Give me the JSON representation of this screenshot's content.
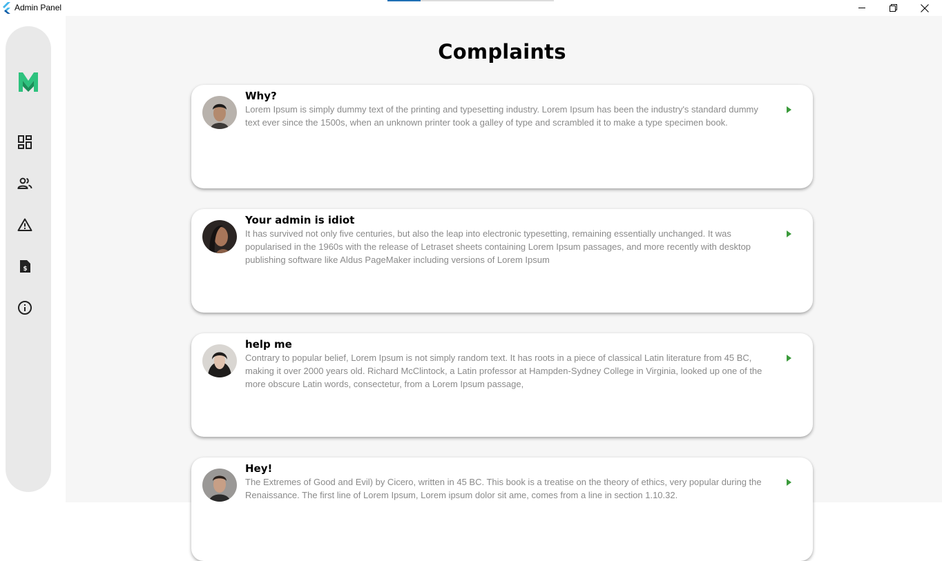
{
  "window": {
    "title": "Admin Panel",
    "progress": 0.2,
    "colors": {
      "accent": "#1f6fb5",
      "brand_green": "#2ec27e",
      "arrow_green": "#3a9a3a"
    }
  },
  "sidebar": {
    "brand_icon": "brand-m-logo-icon",
    "items": [
      {
        "name": "dashboard",
        "icon": "dashboard-icon"
      },
      {
        "name": "users",
        "icon": "people-icon"
      },
      {
        "name": "complaints",
        "icon": "warning-icon"
      },
      {
        "name": "billing",
        "icon": "invoice-icon"
      },
      {
        "name": "about",
        "icon": "info-icon"
      }
    ]
  },
  "page": {
    "title": "Complaints"
  },
  "complaints": [
    {
      "title": "Why?",
      "body": "Lorem Ipsum is simply dummy text of the printing and typesetting industry. Lorem Ipsum has been the industry's standard dummy text ever since the 1500s, when an unknown printer took a galley of type and scrambled it to make a type specimen book."
    },
    {
      "title": "Your admin is idiot",
      "body": "It has survived not only five centuries, but also the leap into electronic typesetting, remaining essentially unchanged. It was popularised in the 1960s with the release of Letraset sheets containing Lorem Ipsum passages, and more recently with desktop publishing software like Aldus PageMaker including versions of Lorem Ipsum"
    },
    {
      "title": "help me",
      "body": "Contrary to popular belief, Lorem Ipsum is not simply random text. It has roots in a piece of classical Latin literature from 45 BC, making it over 2000 years old. Richard McClintock, a Latin professor at Hampden-Sydney College in Virginia, looked up one of the more obscure Latin words, consectetur, from a Lorem Ipsum passage,"
    },
    {
      "title": "Hey!",
      "body": "The Extremes of Good and Evil) by Cicero, written in 45 BC. This book is a treatise on the theory of ethics, very popular during the Renaissance. The first line of Lorem Ipsum, Lorem ipsum dolor sit ame, comes from a line in section 1.10.32."
    }
  ]
}
